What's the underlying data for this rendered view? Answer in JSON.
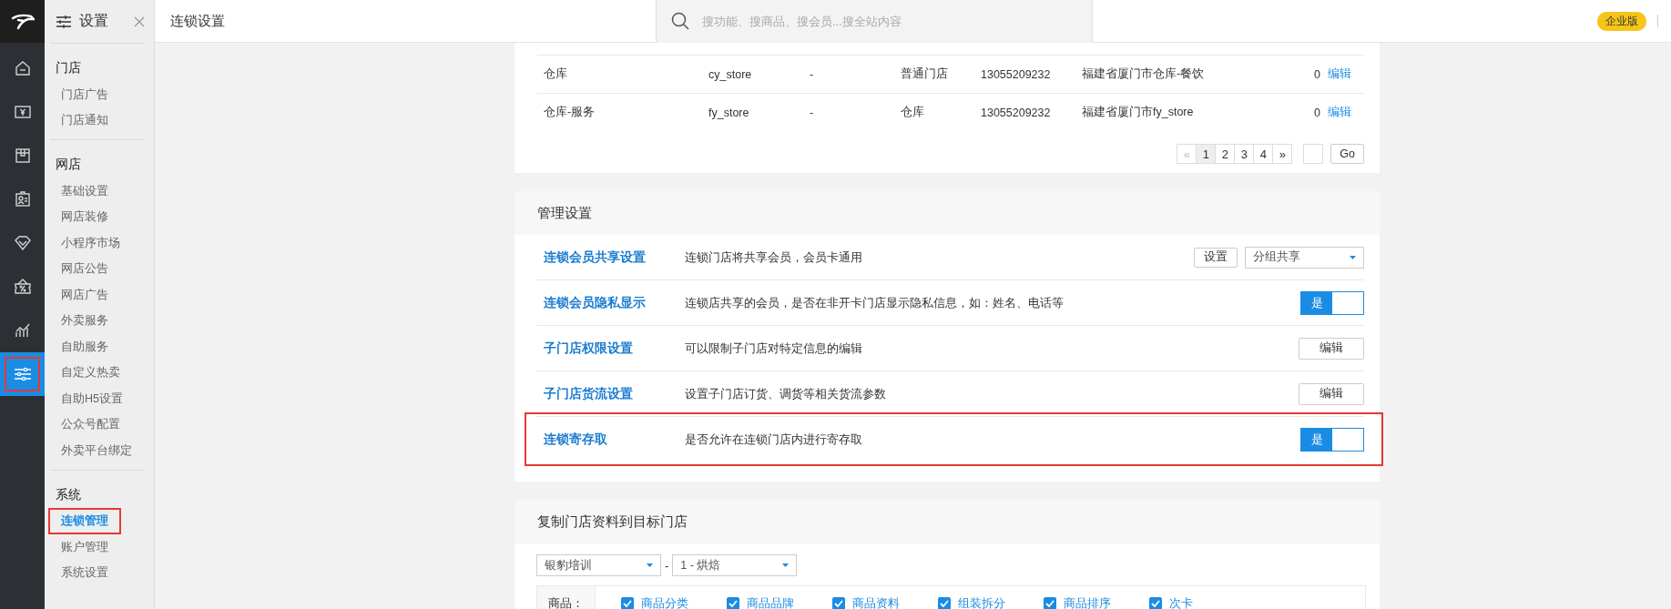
{
  "rail": [
    {
      "selected": false,
      "highlighted": false
    },
    {
      "selected": false,
      "highlighted": false
    },
    {
      "selected": false,
      "highlighted": false
    },
    {
      "selected": false,
      "highlighted": false
    },
    {
      "selected": false,
      "highlighted": false
    },
    {
      "selected": false,
      "highlighted": false
    },
    {
      "selected": false,
      "highlighted": false
    },
    {
      "selected": true,
      "highlighted": true
    }
  ],
  "sidebar": {
    "title": "设置",
    "groups": [
      {
        "title": "门店",
        "items": [
          {
            "label": "门店广告",
            "selected": false,
            "highlighted": false
          },
          {
            "label": "门店通知",
            "selected": false,
            "highlighted": false
          }
        ]
      },
      {
        "title": "网店",
        "items": [
          {
            "label": "基础设置",
            "selected": false,
            "highlighted": false
          },
          {
            "label": "网店装修",
            "selected": false,
            "highlighted": false
          },
          {
            "label": "小程序市场",
            "selected": false,
            "highlighted": false
          },
          {
            "label": "网店公告",
            "selected": false,
            "highlighted": false
          },
          {
            "label": "网店广告",
            "selected": false,
            "highlighted": false
          },
          {
            "label": "外卖服务",
            "selected": false,
            "highlighted": false
          },
          {
            "label": "自助服务",
            "selected": false,
            "highlighted": false
          },
          {
            "label": "自定义热卖",
            "selected": false,
            "highlighted": false
          },
          {
            "label": "自助H5设置",
            "selected": false,
            "highlighted": false
          },
          {
            "label": "公众号配置",
            "selected": false,
            "highlighted": false
          },
          {
            "label": "外卖平台绑定",
            "selected": false,
            "highlighted": false
          }
        ]
      },
      {
        "title": "系统",
        "items": [
          {
            "label": "连锁管理",
            "selected": true,
            "highlighted": true
          },
          {
            "label": "账户管理",
            "selected": false,
            "highlighted": false
          },
          {
            "label": "系统设置",
            "selected": false,
            "highlighted": false
          }
        ]
      }
    ]
  },
  "header": {
    "title": "连锁设置",
    "search": {
      "placeholder": "搜功能、搜商品、搜会员...搜全站内容"
    },
    "badge": "企业版"
  },
  "store_table": {
    "rows": [
      {
        "cells": [
          "仓库",
          "cy_store",
          "-",
          "普通门店",
          "13055209232",
          "福建省厦门市仓库-餐饮",
          "0"
        ],
        "action": "编辑"
      },
      {
        "cells": [
          "仓库-服务",
          "fy_store",
          "-",
          "仓库",
          "13055209232",
          "福建省厦门市fy_store",
          "0"
        ],
        "action": "编辑"
      }
    ],
    "pagination": {
      "prev": "«",
      "pages": [
        {
          "label": "1",
          "selected": true
        },
        {
          "label": "2",
          "selected": false
        },
        {
          "label": "3",
          "selected": false
        },
        {
          "label": "4",
          "selected": false
        }
      ],
      "next": "»",
      "go": "Go"
    }
  },
  "management": {
    "title": "管理设置",
    "rows": [
      {
        "title": "连锁会员共享设置",
        "description": "连锁门店将共享会员，会员卡通用",
        "kind": "select",
        "button": "设置",
        "value": "分组共享",
        "highlighted": false
      },
      {
        "title": "连锁会员隐私显示",
        "description": "连锁店共享的会员，是否在非开卡门店显示隐私信息，如：姓名、电话等",
        "kind": "toggle",
        "label": "是",
        "on": true,
        "highlighted": false
      },
      {
        "title": "子门店权限设置",
        "description": "可以限制子门店对特定信息的编辑",
        "kind": "button",
        "button": "编辑",
        "highlighted": false
      },
      {
        "title": "子门店货流设置",
        "description": "设置子门店订货、调货等相关货流参数",
        "kind": "button",
        "button": "编辑",
        "highlighted": false
      },
      {
        "title": "连锁寄存取",
        "description": "是否允许在连锁门店内进行寄存取",
        "kind": "toggle",
        "label": "是",
        "on": true,
        "highlighted": true
      }
    ]
  },
  "copy": {
    "title": "复制门店资料到目标门店",
    "source": "银豹培训",
    "separator": "-",
    "target": "1 - 烘焙",
    "groups": [
      {
        "label": "商品：",
        "options": [
          {
            "label": "商品分类",
            "checked": true
          },
          {
            "label": "商品品牌",
            "checked": true
          },
          {
            "label": "商品资料",
            "checked": true
          },
          {
            "label": "组装拆分",
            "checked": true
          },
          {
            "label": "商品排序",
            "checked": true
          },
          {
            "label": "次卡",
            "checked": true
          }
        ]
      }
    ]
  }
}
